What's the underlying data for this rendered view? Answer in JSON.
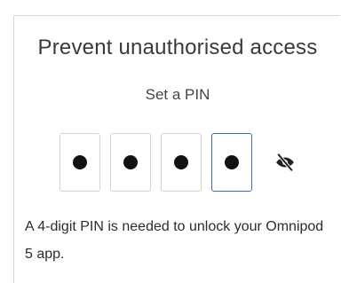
{
  "dialog": {
    "title": "Prevent unauthorised access",
    "subtitle": "Set a PIN",
    "pin": {
      "length": 4,
      "entered_digits": 4,
      "masked": true,
      "active_box": 4
    },
    "visibility_toggle_icon": "eye-off-icon",
    "description": "A 4-digit PIN is needed to unlock your Omnipod 5 app."
  },
  "colors": {
    "title_text": "#3a3a3a",
    "box_border": "#d3d3d3",
    "active_border": "#3f6fa8",
    "dot": "#111111"
  }
}
